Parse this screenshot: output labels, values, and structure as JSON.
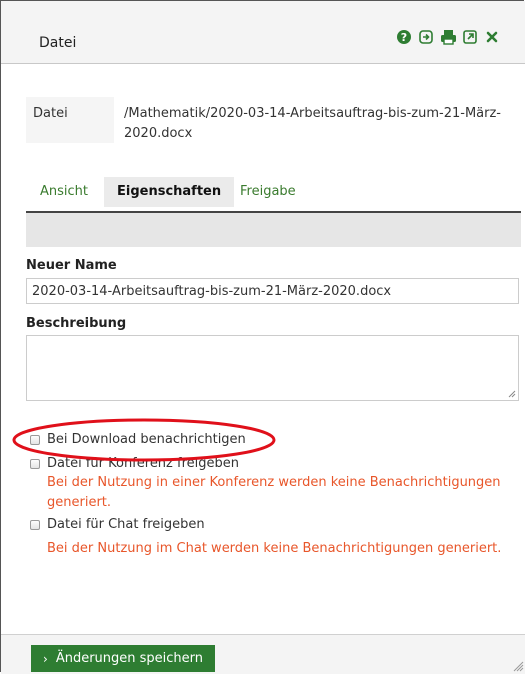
{
  "header": {
    "title": "Datei",
    "icons": [
      "help-icon",
      "enter-icon",
      "print-icon",
      "external-link-icon",
      "close-icon"
    ]
  },
  "info": {
    "label": "Datei",
    "path": "/Mathematik/2020-03-14-Arbeitsauftrag-bis-zum-21-März-2020.docx"
  },
  "tabs": [
    {
      "label": "Ansicht"
    },
    {
      "label": "Eigenschaften"
    },
    {
      "label": "Freigabe"
    }
  ],
  "form": {
    "name_label": "Neuer Name",
    "name_value": "2020-03-14-Arbeitsauftrag-bis-zum-21-März-2020.docx",
    "desc_label": "Beschreibung",
    "desc_value": ""
  },
  "options": [
    {
      "label": "Bei Download benachrichtigen",
      "checked": false
    },
    {
      "label": "Datei für Konferenz freigeben",
      "checked": false,
      "note": "Bei der Nutzung in einer Konferenz werden keine Benachrichtigungen generiert."
    },
    {
      "label": "Datei für Chat freigeben",
      "checked": false,
      "note": "Bei der Nutzung im Chat werden keine Benachrichtigungen generiert."
    }
  ],
  "footer": {
    "save_label": "Änderungen speichern"
  },
  "colors": {
    "accent_green": "#2e7d32",
    "link_green": "#3a7b2e",
    "warning_orange": "#e8562a",
    "highlight_red": "#e0101a"
  }
}
